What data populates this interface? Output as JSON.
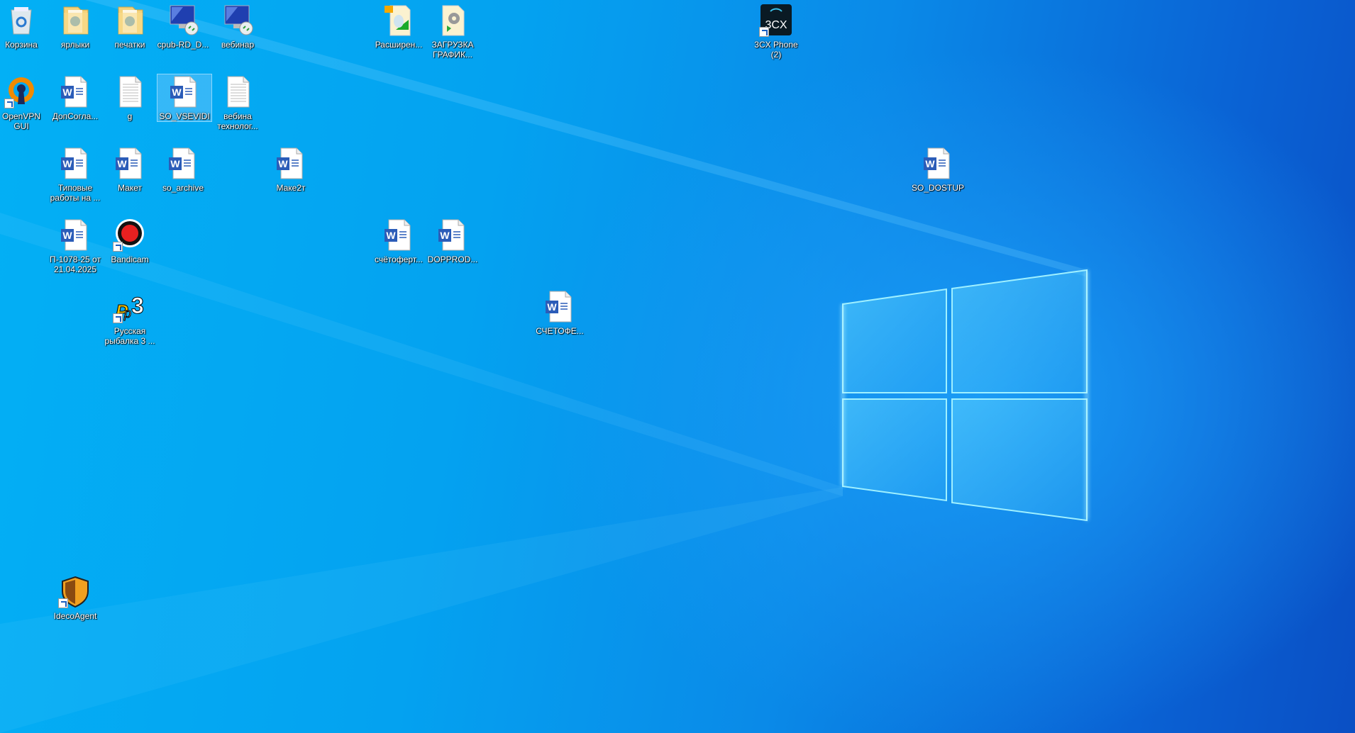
{
  "desktop": {
    "icons": [
      {
        "label": "Корзина",
        "icon": "recycle-bin-icon"
      },
      {
        "label": "ярлыки",
        "icon": "folder-icon"
      },
      {
        "label": "печатки",
        "icon": "folder-icon"
      },
      {
        "label": "cpub-RD_D...",
        "icon": "remote-desktop-icon"
      },
      {
        "label": "вебинар",
        "icon": "remote-desktop-icon"
      },
      {
        "label": "Расширен...",
        "icon": "extension-file-icon"
      },
      {
        "label": "ЗАГРУЗКА ГРАФИК...",
        "icon": "settings-file-icon"
      },
      {
        "label": "3CX Phone (2)",
        "icon": "3cx-phone-icon"
      },
      {
        "label": "OpenVPN GUI",
        "icon": "openvpn-icon"
      },
      {
        "label": "ДопСогла...",
        "icon": "word-document-icon"
      },
      {
        "label": "g",
        "icon": "text-document-icon"
      },
      {
        "label": "SO_VSEVIDI",
        "icon": "word-document-icon"
      },
      {
        "label": "вебина технолог...",
        "icon": "text-document-icon"
      },
      {
        "label": "Типовые работы на ...",
        "icon": "word-document-icon"
      },
      {
        "label": "Макет",
        "icon": "word-document-icon"
      },
      {
        "label": "so_archive",
        "icon": "word-document-icon"
      },
      {
        "label": "Маке2т",
        "icon": "word-document-icon"
      },
      {
        "label": "SO_DOSTUP",
        "icon": "word-document-icon"
      },
      {
        "label": "П-1078-25 от 21.04.2025",
        "icon": "word-document-icon"
      },
      {
        "label": "Bandicam",
        "icon": "bandicam-icon"
      },
      {
        "label": "счётоферт...",
        "icon": "word-document-icon"
      },
      {
        "label": "DOPPROD...",
        "icon": "word-document-icon"
      },
      {
        "label": "Русская рыбалка 3 ...",
        "icon": "rr3-game-icon"
      },
      {
        "label": "СЧЕТОФЕ...",
        "icon": "word-document-icon"
      },
      {
        "label": "IdecoAgent",
        "icon": "shield-icon"
      }
    ],
    "selected": "SO_VSEVIDI"
  }
}
